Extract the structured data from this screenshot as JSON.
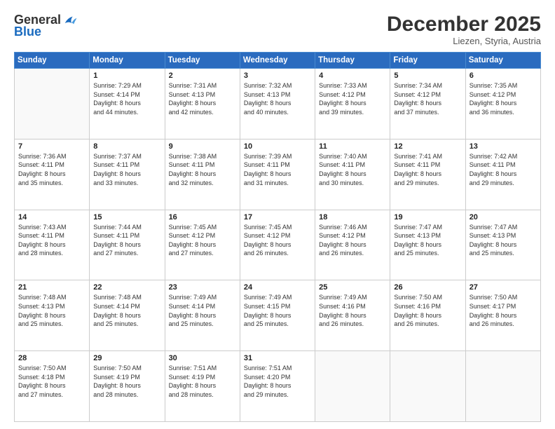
{
  "logo": {
    "general": "General",
    "blue": "Blue"
  },
  "header": {
    "month": "December 2025",
    "location": "Liezen, Styria, Austria"
  },
  "weekdays": [
    "Sunday",
    "Monday",
    "Tuesday",
    "Wednesday",
    "Thursday",
    "Friday",
    "Saturday"
  ],
  "weeks": [
    [
      {
        "day": "",
        "info": ""
      },
      {
        "day": "1",
        "info": "Sunrise: 7:29 AM\nSunset: 4:14 PM\nDaylight: 8 hours\nand 44 minutes."
      },
      {
        "day": "2",
        "info": "Sunrise: 7:31 AM\nSunset: 4:13 PM\nDaylight: 8 hours\nand 42 minutes."
      },
      {
        "day": "3",
        "info": "Sunrise: 7:32 AM\nSunset: 4:13 PM\nDaylight: 8 hours\nand 40 minutes."
      },
      {
        "day": "4",
        "info": "Sunrise: 7:33 AM\nSunset: 4:12 PM\nDaylight: 8 hours\nand 39 minutes."
      },
      {
        "day": "5",
        "info": "Sunrise: 7:34 AM\nSunset: 4:12 PM\nDaylight: 8 hours\nand 37 minutes."
      },
      {
        "day": "6",
        "info": "Sunrise: 7:35 AM\nSunset: 4:12 PM\nDaylight: 8 hours\nand 36 minutes."
      }
    ],
    [
      {
        "day": "7",
        "info": "Sunrise: 7:36 AM\nSunset: 4:11 PM\nDaylight: 8 hours\nand 35 minutes."
      },
      {
        "day": "8",
        "info": "Sunrise: 7:37 AM\nSunset: 4:11 PM\nDaylight: 8 hours\nand 33 minutes."
      },
      {
        "day": "9",
        "info": "Sunrise: 7:38 AM\nSunset: 4:11 PM\nDaylight: 8 hours\nand 32 minutes."
      },
      {
        "day": "10",
        "info": "Sunrise: 7:39 AM\nSunset: 4:11 PM\nDaylight: 8 hours\nand 31 minutes."
      },
      {
        "day": "11",
        "info": "Sunrise: 7:40 AM\nSunset: 4:11 PM\nDaylight: 8 hours\nand 30 minutes."
      },
      {
        "day": "12",
        "info": "Sunrise: 7:41 AM\nSunset: 4:11 PM\nDaylight: 8 hours\nand 29 minutes."
      },
      {
        "day": "13",
        "info": "Sunrise: 7:42 AM\nSunset: 4:11 PM\nDaylight: 8 hours\nand 29 minutes."
      }
    ],
    [
      {
        "day": "14",
        "info": "Sunrise: 7:43 AM\nSunset: 4:11 PM\nDaylight: 8 hours\nand 28 minutes."
      },
      {
        "day": "15",
        "info": "Sunrise: 7:44 AM\nSunset: 4:11 PM\nDaylight: 8 hours\nand 27 minutes."
      },
      {
        "day": "16",
        "info": "Sunrise: 7:45 AM\nSunset: 4:12 PM\nDaylight: 8 hours\nand 27 minutes."
      },
      {
        "day": "17",
        "info": "Sunrise: 7:45 AM\nSunset: 4:12 PM\nDaylight: 8 hours\nand 26 minutes."
      },
      {
        "day": "18",
        "info": "Sunrise: 7:46 AM\nSunset: 4:12 PM\nDaylight: 8 hours\nand 26 minutes."
      },
      {
        "day": "19",
        "info": "Sunrise: 7:47 AM\nSunset: 4:13 PM\nDaylight: 8 hours\nand 25 minutes."
      },
      {
        "day": "20",
        "info": "Sunrise: 7:47 AM\nSunset: 4:13 PM\nDaylight: 8 hours\nand 25 minutes."
      }
    ],
    [
      {
        "day": "21",
        "info": "Sunrise: 7:48 AM\nSunset: 4:13 PM\nDaylight: 8 hours\nand 25 minutes."
      },
      {
        "day": "22",
        "info": "Sunrise: 7:48 AM\nSunset: 4:14 PM\nDaylight: 8 hours\nand 25 minutes."
      },
      {
        "day": "23",
        "info": "Sunrise: 7:49 AM\nSunset: 4:14 PM\nDaylight: 8 hours\nand 25 minutes."
      },
      {
        "day": "24",
        "info": "Sunrise: 7:49 AM\nSunset: 4:15 PM\nDaylight: 8 hours\nand 25 minutes."
      },
      {
        "day": "25",
        "info": "Sunrise: 7:49 AM\nSunset: 4:16 PM\nDaylight: 8 hours\nand 26 minutes."
      },
      {
        "day": "26",
        "info": "Sunrise: 7:50 AM\nSunset: 4:16 PM\nDaylight: 8 hours\nand 26 minutes."
      },
      {
        "day": "27",
        "info": "Sunrise: 7:50 AM\nSunset: 4:17 PM\nDaylight: 8 hours\nand 26 minutes."
      }
    ],
    [
      {
        "day": "28",
        "info": "Sunrise: 7:50 AM\nSunset: 4:18 PM\nDaylight: 8 hours\nand 27 minutes."
      },
      {
        "day": "29",
        "info": "Sunrise: 7:50 AM\nSunset: 4:19 PM\nDaylight: 8 hours\nand 28 minutes."
      },
      {
        "day": "30",
        "info": "Sunrise: 7:51 AM\nSunset: 4:19 PM\nDaylight: 8 hours\nand 28 minutes."
      },
      {
        "day": "31",
        "info": "Sunrise: 7:51 AM\nSunset: 4:20 PM\nDaylight: 8 hours\nand 29 minutes."
      },
      {
        "day": "",
        "info": ""
      },
      {
        "day": "",
        "info": ""
      },
      {
        "day": "",
        "info": ""
      }
    ]
  ]
}
